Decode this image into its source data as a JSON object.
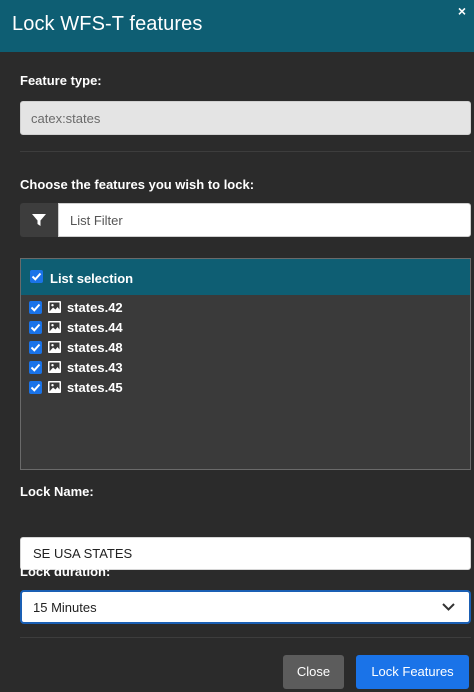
{
  "dialog": {
    "title": "Lock WFS-T features",
    "close_glyph": "×"
  },
  "feature_type": {
    "label": "Feature type:",
    "value": "catex:states"
  },
  "features": {
    "label": "Choose the features you wish to lock:",
    "filter_placeholder": "List Filter",
    "filter_icon": "funnel-icon",
    "list_header": "List selection",
    "list_header_checked": true,
    "items": [
      {
        "label": "states.42",
        "checked": true
      },
      {
        "label": "states.44",
        "checked": true
      },
      {
        "label": "states.48",
        "checked": true
      },
      {
        "label": "states.43",
        "checked": true
      },
      {
        "label": "states.45",
        "checked": true
      }
    ]
  },
  "lock_name": {
    "label": "Lock Name:",
    "value": "SE USA STATES"
  },
  "lock_duration": {
    "label": "Lock duration:",
    "selected": "15 Minutes"
  },
  "footer": {
    "close_label": "Close",
    "lock_label": "Lock Features"
  },
  "colors": {
    "header_bg": "#0e5e73",
    "dialog_bg": "#2b2b2b",
    "primary_button": "#1a73e8",
    "secondary_button": "#5c5c5c",
    "checkbox": "#1a73e8"
  }
}
